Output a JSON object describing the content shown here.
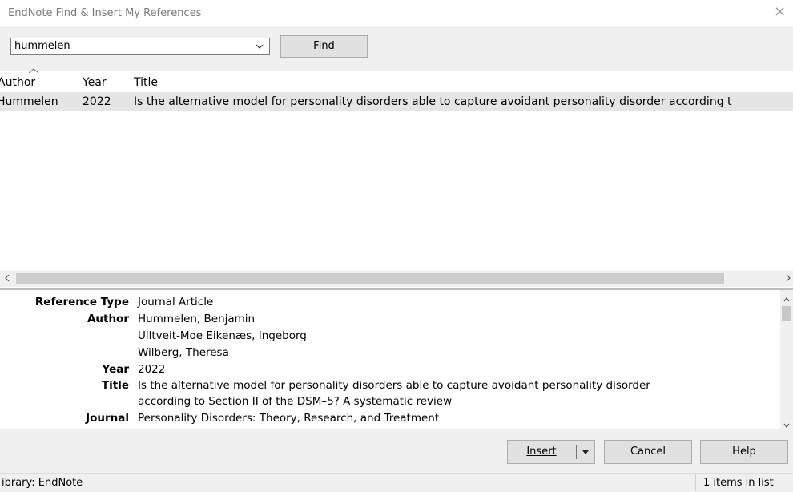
{
  "window": {
    "title": "EndNote Find & Insert My References",
    "close_glyph": "×"
  },
  "search": {
    "value": "hummelen",
    "find_label": "Find"
  },
  "list": {
    "headers": {
      "author": "Author",
      "year": "Year",
      "title": "Title"
    },
    "rows": [
      {
        "author": "Hummelen",
        "year": "2022",
        "title": "Is the alternative model for personality disorders able to capture avoidant personality disorder according t"
      }
    ]
  },
  "details": {
    "reference_type_label": "Reference Type",
    "reference_type": "Journal Article",
    "author_label": "Author",
    "authors": [
      "Hummelen, Benjamin",
      "Ulltveit-Moe Eikenæs, Ingeborg",
      "Wilberg, Theresa"
    ],
    "year_label": "Year",
    "year": "2022",
    "title_label": "Title",
    "title_lines": [
      "Is the alternative model for personality disorders able to capture avoidant personality disorder",
      "according to Section II of the DSM–5? A systematic review"
    ],
    "journal_label": "Journal",
    "journal": "Personality Disorders: Theory, Research, and Treatment"
  },
  "buttons": {
    "insert": "Insert",
    "cancel": "Cancel",
    "help": "Help"
  },
  "status": {
    "library": "ibrary: EndNote",
    "count": "1 items in list"
  }
}
